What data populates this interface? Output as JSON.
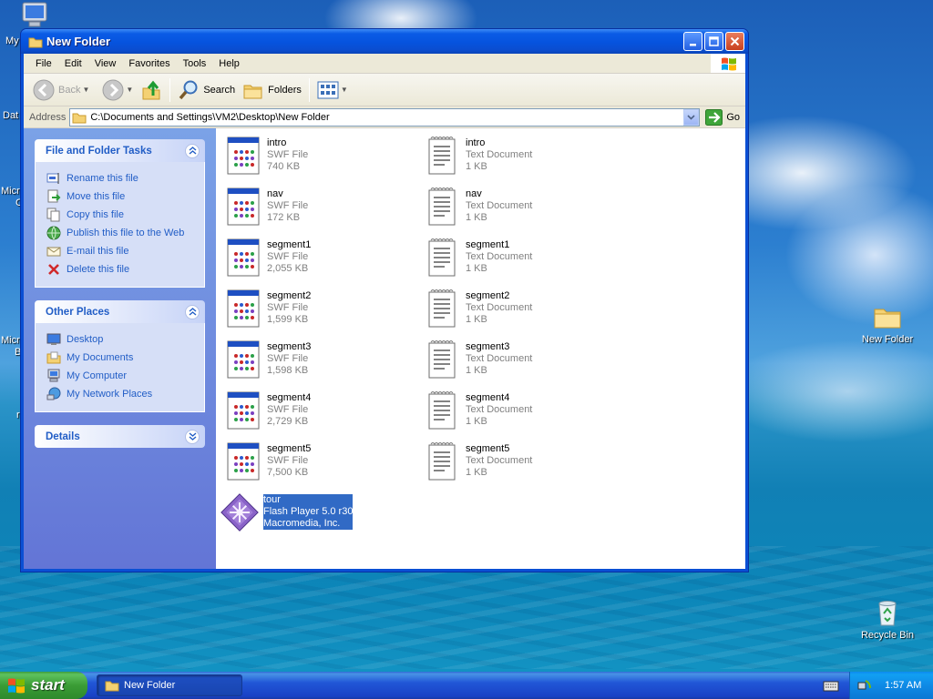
{
  "window": {
    "title": "New Folder",
    "menu": [
      "File",
      "Edit",
      "View",
      "Favorites",
      "Tools",
      "Help"
    ],
    "toolbar": {
      "back_label": "Back",
      "search_label": "Search",
      "folders_label": "Folders"
    },
    "address": {
      "label": "Address",
      "value": "C:\\Documents and Settings\\VM2\\Desktop\\New Folder",
      "go_label": "Go"
    }
  },
  "taskpane": {
    "file_tasks": {
      "title": "File and Folder Tasks",
      "items": [
        {
          "label": "Rename this file",
          "icon": "rename-icon"
        },
        {
          "label": "Move this file",
          "icon": "move-icon"
        },
        {
          "label": "Copy this file",
          "icon": "copy-icon"
        },
        {
          "label": "Publish this file to the Web",
          "icon": "globe-icon"
        },
        {
          "label": "E-mail this file",
          "icon": "email-icon"
        },
        {
          "label": "Delete this file",
          "icon": "delete-icon"
        }
      ]
    },
    "other_places": {
      "title": "Other Places",
      "items": [
        {
          "label": "Desktop",
          "icon": "desktop-icon"
        },
        {
          "label": "My Documents",
          "icon": "my-documents-icon"
        },
        {
          "label": "My Computer",
          "icon": "my-computer-icon"
        },
        {
          "label": "My Network Places",
          "icon": "network-places-icon"
        }
      ]
    },
    "details": {
      "title": "Details"
    }
  },
  "files": [
    {
      "name": "intro",
      "type": "SWF File",
      "size": "740 KB",
      "icon": "swf-file-icon"
    },
    {
      "name": "intro",
      "type": "Text Document",
      "size": "1 KB",
      "icon": "text-document-icon"
    },
    {
      "name": "nav",
      "type": "SWF File",
      "size": "172 KB",
      "icon": "swf-file-icon"
    },
    {
      "name": "nav",
      "type": "Text Document",
      "size": "1 KB",
      "icon": "text-document-icon"
    },
    {
      "name": "segment1",
      "type": "SWF File",
      "size": "2,055 KB",
      "icon": "swf-file-icon"
    },
    {
      "name": "segment1",
      "type": "Text Document",
      "size": "1 KB",
      "icon": "text-document-icon"
    },
    {
      "name": "segment2",
      "type": "SWF File",
      "size": "1,599 KB",
      "icon": "swf-file-icon"
    },
    {
      "name": "segment2",
      "type": "Text Document",
      "size": "1 KB",
      "icon": "text-document-icon"
    },
    {
      "name": "segment3",
      "type": "SWF File",
      "size": "1,598 KB",
      "icon": "swf-file-icon"
    },
    {
      "name": "segment3",
      "type": "Text Document",
      "size": "1 KB",
      "icon": "text-document-icon"
    },
    {
      "name": "segment4",
      "type": "SWF File",
      "size": "2,729 KB",
      "icon": "swf-file-icon"
    },
    {
      "name": "segment4",
      "type": "Text Document",
      "size": "1 KB",
      "icon": "text-document-icon"
    },
    {
      "name": "segment5",
      "type": "SWF File",
      "size": "7,500 KB",
      "icon": "swf-file-icon"
    },
    {
      "name": "segment5",
      "type": "Text Document",
      "size": "1 KB",
      "icon": "text-document-icon"
    },
    {
      "name": "tour",
      "type": "Flash Player 5.0 r30",
      "size": "Macromedia, Inc.",
      "icon": "flash-player-icon",
      "selected": true
    }
  ],
  "desktop": {
    "icons": [
      {
        "label": "New Folder",
        "icon": "folder-icon"
      },
      {
        "label": "Recycle Bin",
        "icon": "recycle-bin-icon"
      }
    ],
    "edge_labels": [
      "My",
      "Dat",
      "Micro",
      "C",
      "Micro",
      "B",
      "r"
    ]
  },
  "taskbar": {
    "start_label": "start",
    "tasks": [
      {
        "label": "New Folder",
        "icon": "folder-icon"
      }
    ],
    "clock": "1:57 AM"
  },
  "colors": {
    "title_blue": "#0653de",
    "selection": "#316ac5",
    "link_blue": "#215dc6",
    "start_green": "#3a9c35"
  }
}
